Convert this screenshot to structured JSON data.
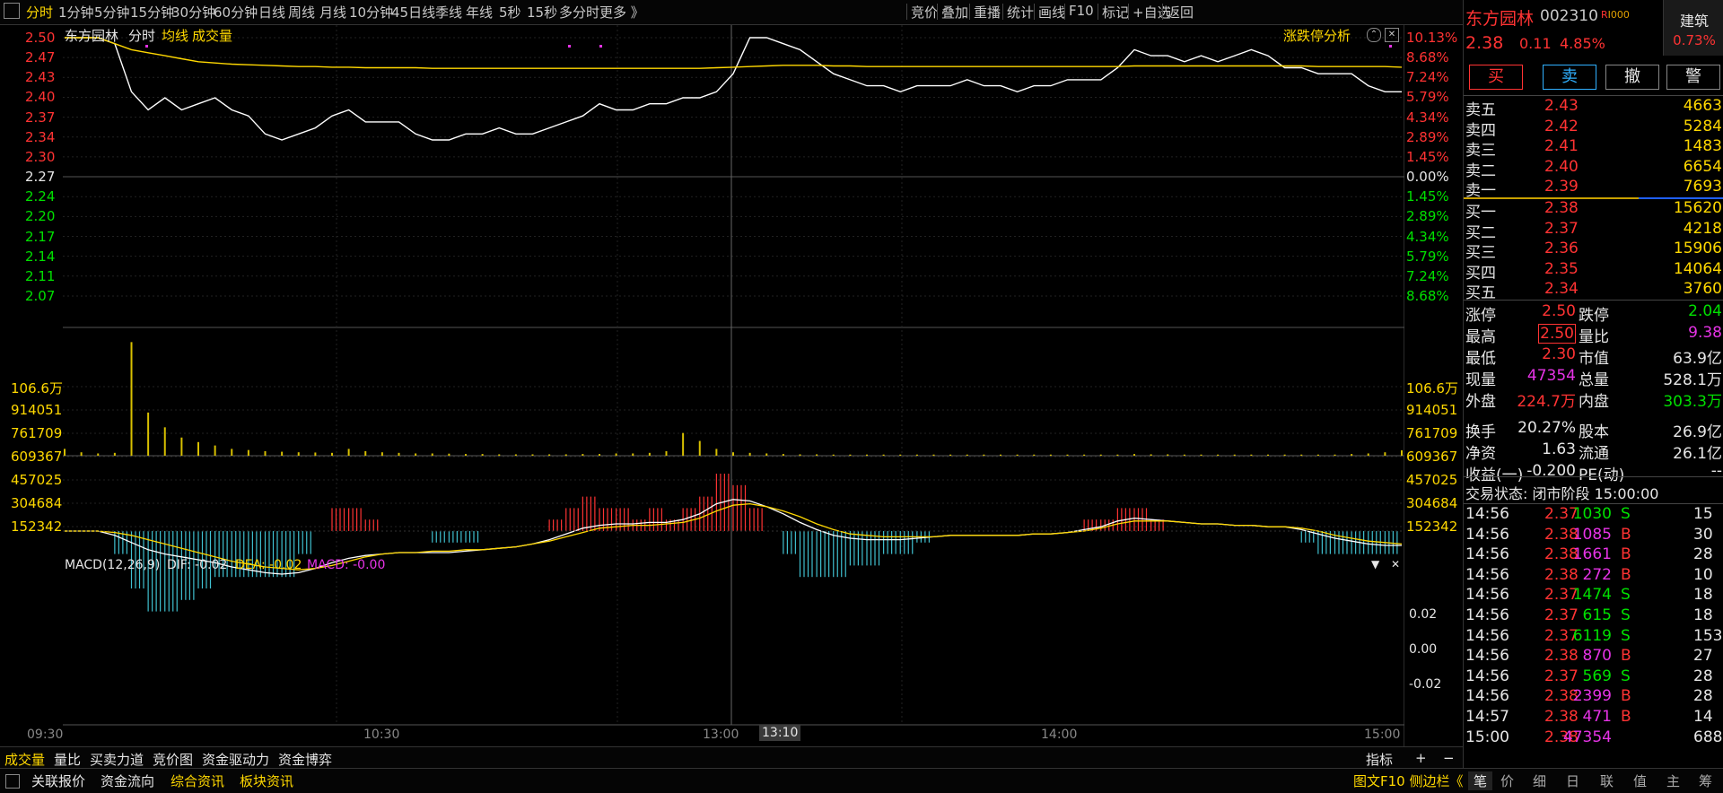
{
  "toolbar": {
    "timeframes": [
      "分时",
      "1分钟",
      "5分钟",
      "15分钟",
      "30分钟",
      "60分钟",
      "日线",
      "周线",
      "月线",
      "10分钟",
      "45日线",
      "季线",
      "年线",
      "5秒",
      "15秒",
      "多分时",
      "更多 》"
    ],
    "right_items": [
      "竞价",
      "叠加",
      "重播",
      "统计",
      "画线",
      "F10",
      "标记",
      "+自选",
      "返回"
    ]
  },
  "chart": {
    "stock_name": "东方园林",
    "mode_label": "分时",
    "avg_label": "均线",
    "vol_label": "成交量",
    "limit_analysis": "涨跌停分析",
    "price_ticks": [
      "2.50",
      "2.47",
      "2.43",
      "2.40",
      "2.37",
      "2.34",
      "2.30",
      "2.27",
      "2.24",
      "2.20",
      "2.17",
      "2.14",
      "2.11",
      "2.07"
    ],
    "pct_ticks": [
      "10.13%",
      "8.68%",
      "7.24%",
      "5.79%",
      "4.34%",
      "2.89%",
      "1.45%",
      "0.00%",
      "1.45%",
      "2.89%",
      "4.34%",
      "5.79%",
      "7.24%",
      "8.68%"
    ],
    "vol_ticks": [
      "106.6万",
      "914051",
      "761709",
      "609367",
      "457025",
      "304684",
      "152342"
    ],
    "macd_header": {
      "name": "MACD(12,26,9)",
      "dif": "DIF: -0.02",
      "dea": "DEA: -0.02",
      "macd": "MACD: -0.00"
    },
    "macd_ticks": [
      "0.02",
      "0.00",
      "-0.02"
    ],
    "time_ticks": [
      "09:30",
      "10:30",
      "13:00",
      "14:00",
      "15:00"
    ],
    "crosshair_time": "13:10"
  },
  "chart_data": {
    "type": "line",
    "title": "东方园林 分时",
    "ylim": [
      2.06,
      2.51
    ],
    "series": [
      {
        "name": "分时",
        "values": [
          2.5,
          2.5,
          2.5,
          2.49,
          2.41,
          2.38,
          2.4,
          2.38,
          2.39,
          2.4,
          2.38,
          2.37,
          2.34,
          2.33,
          2.34,
          2.35,
          2.37,
          2.38,
          2.36,
          2.36,
          2.36,
          2.34,
          2.33,
          2.33,
          2.34,
          2.34,
          2.35,
          2.34,
          2.34,
          2.35,
          2.36,
          2.37,
          2.39,
          2.38,
          2.38,
          2.39,
          2.39,
          2.4,
          2.4,
          2.41,
          2.44,
          2.5,
          2.5,
          2.49,
          2.48,
          2.46,
          2.44,
          2.43,
          2.42,
          2.42,
          2.41,
          2.42,
          2.42,
          2.42,
          2.43,
          2.42,
          2.42,
          2.41,
          2.42,
          2.42,
          2.43,
          2.43,
          2.43,
          2.45,
          2.48,
          2.47,
          2.47,
          2.46,
          2.47,
          2.46,
          2.47,
          2.48,
          2.47,
          2.45,
          2.45,
          2.44,
          2.44,
          2.44,
          2.42,
          2.41,
          2.41
        ]
      },
      {
        "name": "均线",
        "values": [
          2.5,
          2.5,
          2.5,
          2.49,
          2.48,
          2.475,
          2.47,
          2.465,
          2.46,
          2.458,
          2.456,
          2.455,
          2.454,
          2.453,
          2.452,
          2.452,
          2.451,
          2.451,
          2.45,
          2.45,
          2.45,
          2.45,
          2.449,
          2.449,
          2.449,
          2.449,
          2.449,
          2.449,
          2.449,
          2.449,
          2.449,
          2.449,
          2.449,
          2.449,
          2.449,
          2.449,
          2.449,
          2.449,
          2.449,
          2.45,
          2.451,
          2.452,
          2.453,
          2.454,
          2.454,
          2.454,
          2.453,
          2.453,
          2.452,
          2.452,
          2.452,
          2.452,
          2.452,
          2.452,
          2.452,
          2.452,
          2.452,
          2.452,
          2.452,
          2.452,
          2.452,
          2.452,
          2.452,
          2.452,
          2.453,
          2.453,
          2.453,
          2.453,
          2.453,
          2.453,
          2.453,
          2.453,
          2.453,
          2.453,
          2.453,
          2.452,
          2.452,
          2.452,
          2.452,
          2.452,
          2.451
        ]
      }
    ],
    "volume": [
      60000,
      30000,
      20000,
      25000,
      1000000,
      380000,
      250000,
      160000,
      120000,
      90000,
      60000,
      50000,
      40000,
      35000,
      30000,
      28000,
      25000,
      60000,
      40000,
      30000,
      25000,
      20000,
      20000,
      18000,
      15000,
      15000,
      12000,
      12000,
      12000,
      12000,
      12000,
      15000,
      15000,
      20000,
      20000,
      25000,
      40000,
      200000,
      130000,
      60000,
      30000,
      25000,
      20000,
      15000,
      12000,
      12000,
      10000,
      10000,
      10000,
      10000,
      10000,
      10000,
      10000,
      10000,
      10000,
      10000,
      10000,
      10000,
      10000,
      10000,
      10000,
      10000,
      10000,
      10000,
      15000,
      12000,
      12000,
      10000,
      10000,
      10000,
      10000,
      10000,
      10000,
      10000,
      10000,
      10000,
      10000,
      15000,
      20000,
      30000,
      47354
    ],
    "macd": {
      "dif": [
        0,
        0,
        0,
        -0.003,
        -0.008,
        -0.013,
        -0.016,
        -0.018,
        -0.02,
        -0.022,
        -0.025,
        -0.027,
        -0.029,
        -0.03,
        -0.029,
        -0.026,
        -0.022,
        -0.019,
        -0.017,
        -0.016,
        -0.015,
        -0.015,
        -0.015,
        -0.015,
        -0.014,
        -0.013,
        -0.012,
        -0.011,
        -0.009,
        -0.006,
        -0.002,
        0.002,
        0.004,
        0.005,
        0.005,
        0.006,
        0.006,
        0.008,
        0.012,
        0.019,
        0.022,
        0.021,
        0.017,
        0.012,
        0.006,
        0.001,
        -0.003,
        -0.005,
        -0.006,
        -0.006,
        -0.006,
        -0.005,
        -0.004,
        -0.003,
        -0.003,
        -0.003,
        -0.003,
        -0.003,
        -0.002,
        -0.002,
        -0.001,
        0.001,
        0.003,
        0.007,
        0.009,
        0.008,
        0.007,
        0.006,
        0.005,
        0.005,
        0.004,
        0.004,
        0.003,
        0.003,
        0.001,
        -0.002,
        -0.005,
        -0.007,
        -0.009,
        -0.01,
        -0.01
      ],
      "dea": [
        0,
        0,
        0,
        -0.001,
        -0.003,
        -0.006,
        -0.009,
        -0.012,
        -0.015,
        -0.018,
        -0.021,
        -0.023,
        -0.025,
        -0.026,
        -0.027,
        -0.026,
        -0.024,
        -0.021,
        -0.018,
        -0.016,
        -0.015,
        -0.015,
        -0.014,
        -0.014,
        -0.013,
        -0.013,
        -0.012,
        -0.011,
        -0.009,
        -0.007,
        -0.004,
        -0.001,
        0.002,
        0.003,
        0.004,
        0.004,
        0.005,
        0.006,
        0.009,
        0.014,
        0.018,
        0.019,
        0.017,
        0.014,
        0.01,
        0.005,
        0.001,
        -0.002,
        -0.003,
        -0.004,
        -0.004,
        -0.004,
        -0.004,
        -0.003,
        -0.003,
        -0.003,
        -0.003,
        -0.003,
        -0.002,
        -0.002,
        -0.001,
        0.0,
        0.002,
        0.005,
        0.007,
        0.007,
        0.007,
        0.006,
        0.005,
        0.005,
        0.004,
        0.004,
        0.003,
        0.003,
        0.002,
        0.0,
        -0.003,
        -0.005,
        -0.007,
        -0.008,
        -0.009
      ]
    }
  },
  "order_panel": {
    "name": "东方园林",
    "code": "002310",
    "badge": "R",
    "sector": "建筑",
    "sector_pct": "0.73%",
    "price": "2.38",
    "change": "0.11",
    "change_pct": "4.85%",
    "buttons": [
      "买",
      "卖",
      "撤",
      "警"
    ],
    "asks": [
      {
        "label": "卖五",
        "price": "2.43",
        "vol": "4663"
      },
      {
        "label": "卖四",
        "price": "2.42",
        "vol": "5284"
      },
      {
        "label": "卖三",
        "price": "2.41",
        "vol": "1483"
      },
      {
        "label": "卖二",
        "price": "2.40",
        "vol": "6654"
      },
      {
        "label": "卖一",
        "price": "2.39",
        "vol": "7693"
      }
    ],
    "bids": [
      {
        "label": "买一",
        "price": "2.38",
        "vol": "15620"
      },
      {
        "label": "买二",
        "price": "2.37",
        "vol": "4218"
      },
      {
        "label": "买三",
        "price": "2.36",
        "vol": "15906"
      },
      {
        "label": "买四",
        "price": "2.35",
        "vol": "14064"
      },
      {
        "label": "买五",
        "price": "2.34",
        "vol": "3760"
      }
    ],
    "stats": [
      [
        "涨停",
        "2.50",
        "跌停",
        "2.04"
      ],
      [
        "最高",
        "2.50",
        "量比",
        "9.38"
      ],
      [
        "最低",
        "2.30",
        "市值",
        "63.9亿"
      ],
      [
        "现量",
        "47354",
        "总量",
        "528.1万"
      ],
      [
        "外盘",
        "224.7万",
        "内盘",
        "303.3万"
      ],
      [
        "换手",
        "20.27%",
        "股本",
        "26.9亿"
      ],
      [
        "净资",
        "1.63",
        "流通",
        "26.1亿"
      ],
      [
        "收益(一)",
        "-0.200",
        "PE(动)",
        "--"
      ]
    ],
    "status": "交易状态: 闭市阶段 15:00:00",
    "ticks": [
      [
        "14:56",
        "2.37",
        "1030",
        "S",
        "15"
      ],
      [
        "14:56",
        "2.38",
        "1085",
        "B",
        "30"
      ],
      [
        "14:56",
        "2.38",
        "1661",
        "B",
        "28"
      ],
      [
        "14:56",
        "2.38",
        "272",
        "B",
        "10"
      ],
      [
        "14:56",
        "2.37",
        "1474",
        "S",
        "18"
      ],
      [
        "14:56",
        "2.37",
        "615",
        "S",
        "18"
      ],
      [
        "14:56",
        "2.37",
        "6119",
        "S",
        "153"
      ],
      [
        "14:56",
        "2.38",
        "870",
        "B",
        "27"
      ],
      [
        "14:56",
        "2.37",
        "569",
        "S",
        "28"
      ],
      [
        "14:56",
        "2.38",
        "2399",
        "B",
        "28"
      ],
      [
        "14:57",
        "2.38",
        "471",
        "B",
        "14"
      ],
      [
        "15:00",
        "2.38",
        "47354",
        "",
        "688"
      ]
    ],
    "bottom_tabs": [
      "笔",
      "价",
      "细",
      "日",
      "联",
      "值",
      "主",
      "筹"
    ]
  },
  "bottom": {
    "indicators": [
      "成交量",
      "量比",
      "买卖力道",
      "竞价图",
      "资金驱动力",
      "资金博弈"
    ],
    "indicator_btn": "指标",
    "links": [
      "关联报价",
      "资金流向",
      "综合资讯",
      "板块资讯"
    ],
    "right_text": "图文F10 侧边栏《"
  },
  "colors": {
    "up": "#ff3333",
    "down": "#00e000",
    "avg": "#ffd800",
    "price_line": "#ffffff",
    "bg": "#000000"
  }
}
